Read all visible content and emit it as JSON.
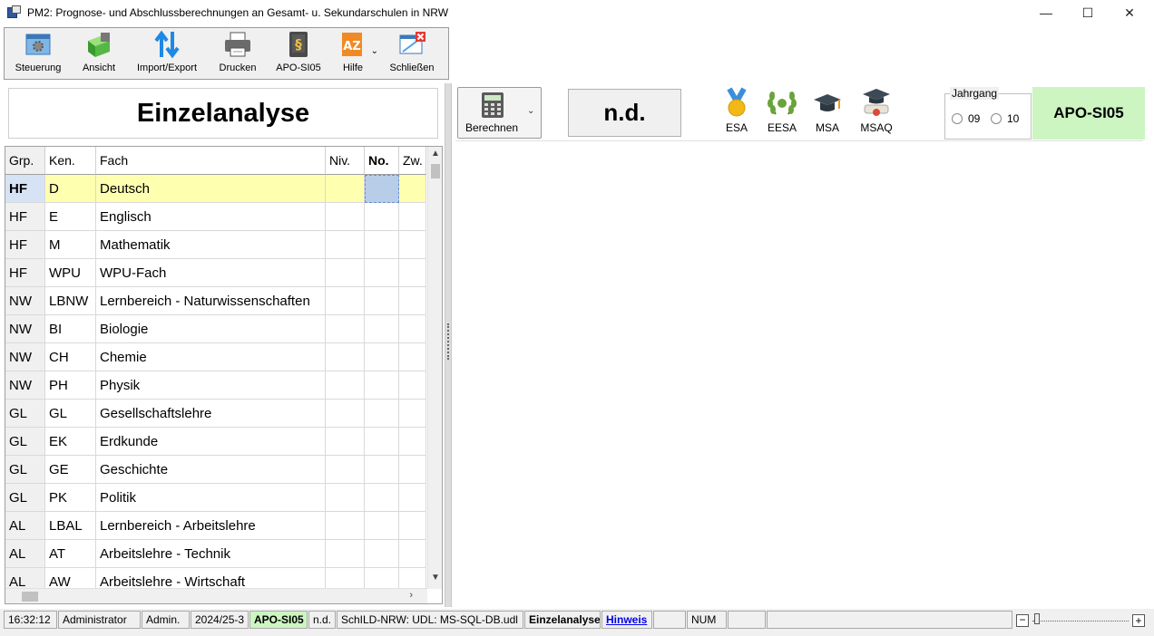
{
  "window": {
    "title": "PM2: Prognose- und Abschlussberechnungen an Gesamt- u. Sekundarschulen in NRW",
    "minimize": "—",
    "maximize": "☐",
    "close": "✕"
  },
  "toolbar": {
    "items": [
      {
        "label": "Steuerung",
        "icon": "settings-icon"
      },
      {
        "label": "Ansicht",
        "icon": "view-cube-icon"
      },
      {
        "label": "Import/Export",
        "icon": "import-export-arrows-icon"
      },
      {
        "label": "Drucken",
        "icon": "printer-icon"
      },
      {
        "label": "APO-SI05",
        "icon": "law-book-icon"
      },
      {
        "label": "Hilfe",
        "icon": "help-az-icon"
      },
      {
        "label": "Schließen",
        "icon": "close-window-icon"
      }
    ]
  },
  "left_panel": {
    "title": "Einzelanalyse",
    "columns": [
      "Grp.",
      "Ken.",
      "Fach",
      "Niv.",
      "No.",
      "Zw."
    ],
    "rows": [
      {
        "grp": "HF",
        "ken": "D",
        "fach": "Deutsch",
        "niv": "",
        "no": "",
        "zw": ""
      },
      {
        "grp": "HF",
        "ken": "E",
        "fach": "Englisch",
        "niv": "",
        "no": "",
        "zw": ""
      },
      {
        "grp": "HF",
        "ken": "M",
        "fach": "Mathematik",
        "niv": "",
        "no": "",
        "zw": ""
      },
      {
        "grp": "HF",
        "ken": "WPU",
        "fach": "WPU-Fach",
        "niv": "",
        "no": "",
        "zw": ""
      },
      {
        "grp": "NW",
        "ken": "LBNW",
        "fach": "Lernbereich - Naturwissenschaften",
        "niv": "",
        "no": "",
        "zw": ""
      },
      {
        "grp": "NW",
        "ken": "BI",
        "fach": "Biologie",
        "niv": "",
        "no": "",
        "zw": ""
      },
      {
        "grp": "NW",
        "ken": "CH",
        "fach": "Chemie",
        "niv": "",
        "no": "",
        "zw": ""
      },
      {
        "grp": "NW",
        "ken": "PH",
        "fach": "Physik",
        "niv": "",
        "no": "",
        "zw": ""
      },
      {
        "grp": "GL",
        "ken": "GL",
        "fach": "Gesellschaftslehre",
        "niv": "",
        "no": "",
        "zw": ""
      },
      {
        "grp": "GL",
        "ken": "EK",
        "fach": "Erdkunde",
        "niv": "",
        "no": "",
        "zw": ""
      },
      {
        "grp": "GL",
        "ken": "GE",
        "fach": "Geschichte",
        "niv": "",
        "no": "",
        "zw": ""
      },
      {
        "grp": "GL",
        "ken": "PK",
        "fach": "Politik",
        "niv": "",
        "no": "",
        "zw": ""
      },
      {
        "grp": "AL",
        "ken": "LBAL",
        "fach": "Lernbereich - Arbeitslehre",
        "niv": "",
        "no": "",
        "zw": ""
      },
      {
        "grp": "AL",
        "ken": "AT",
        "fach": "Arbeitslehre - Technik",
        "niv": "",
        "no": "",
        "zw": ""
      },
      {
        "grp": "AL",
        "ken": "AW",
        "fach": "Arbeitslehre - Wirtschaft",
        "niv": "",
        "no": "",
        "zw": ""
      }
    ],
    "selected_row": 0
  },
  "right_panel": {
    "berechnen_label": "Berechnen",
    "status_value": "n.d.",
    "abschluesse": [
      {
        "label": "ESA",
        "icon": "medal-icon"
      },
      {
        "label": "EESA",
        "icon": "laurel-wreath-icon"
      },
      {
        "label": "MSA",
        "icon": "graduation-cap-icon"
      },
      {
        "label": "MSAQ",
        "icon": "graduation-cap-diploma-icon"
      }
    ],
    "jahrgang": {
      "label": "Jahrgang",
      "options": [
        "09",
        "10"
      ]
    },
    "apo_label": "APO-SI05"
  },
  "statusbar": {
    "time": "16:32:12",
    "user": "Administrator",
    "role": "Admin.",
    "schoolyear": "2024/25-3",
    "apo": "APO-SI05",
    "nd": "n.d.",
    "db": "SchILD-NRW: UDL: MS-SQL-DB.udl",
    "mode": "Einzelanalyse",
    "hint": "Hinweis",
    "num": "NUM",
    "zoom_minus": "−",
    "zoom_plus": "+"
  },
  "colors": {
    "selected_row": "#ffffb0",
    "apo_box": "#ccf5c1",
    "link": "#0000ee"
  }
}
